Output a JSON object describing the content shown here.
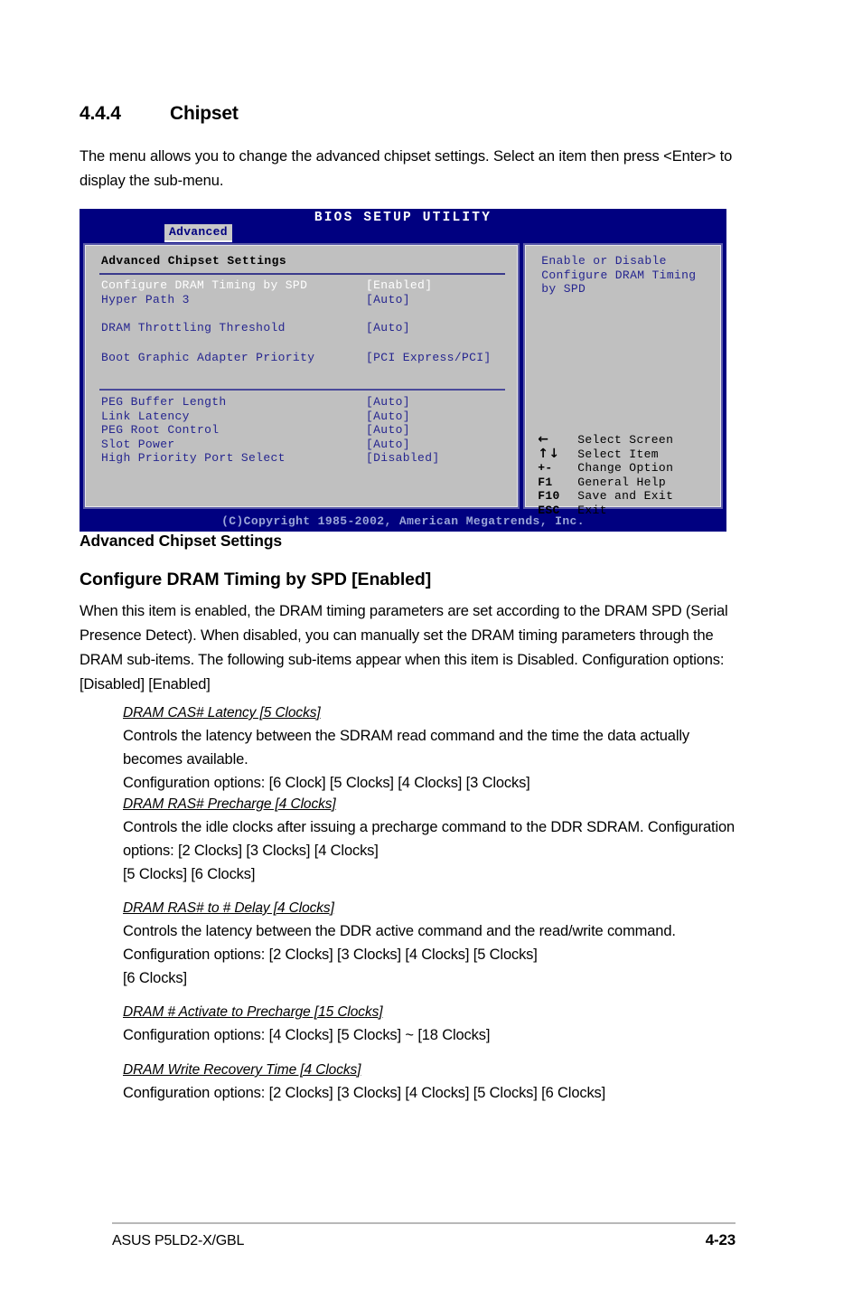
{
  "section": {
    "number": "4.4.4",
    "title": "Chipset",
    "intro": "The menu allows you to change the advanced chipset settings. Select an item then press <Enter> to display the sub-menu."
  },
  "bios": {
    "title": "BIOS SETUP UTILITY",
    "tab": "Advanced",
    "panel_heading": "Advanced Chipset Settings",
    "settings_group_1": [
      {
        "label": "Configure DRAM Timing by SPD",
        "value": "[Enabled]",
        "selected": true
      },
      {
        "label": "Hyper Path 3",
        "value": "[Auto]",
        "selected": false
      },
      {
        "label": "DRAM Throttling Threshold",
        "value": "[Auto]",
        "selected": false
      }
    ],
    "settings_group_2": [
      {
        "label": "Boot Graphic Adapter Priority",
        "value": "[PCI Express/PCI]",
        "selected": false
      }
    ],
    "settings_group_3": [
      {
        "label": "PEG Buffer Length",
        "value": "[Auto]",
        "selected": false
      },
      {
        "label": "Link Latency",
        "value": "[Auto]",
        "selected": false
      },
      {
        "label": "PEG Root Control",
        "value": "[Auto]",
        "selected": false
      },
      {
        "label": "Slot Power",
        "value": "[Auto]",
        "selected": false
      },
      {
        "label": "High Priority Port Select",
        "value": "[Disabled]",
        "selected": false
      }
    ],
    "help_text": "Enable or Disable\nConfigure DRAM Timing\nby SPD",
    "legend": [
      {
        "key": "←",
        "symbol": true,
        "text": "Select Screen"
      },
      {
        "key": "↑↓",
        "symbol": true,
        "text": "Select Item"
      },
      {
        "key": "+-",
        "symbol": false,
        "text": "Change Option"
      },
      {
        "key": "F1",
        "symbol": false,
        "text": "General Help"
      },
      {
        "key": "F10",
        "symbol": false,
        "text": "Save and Exit"
      },
      {
        "key": "ESC",
        "symbol": false,
        "text": "Exit"
      }
    ],
    "copyright": "(C)Copyright 1985-2002, American Megatrends, Inc.",
    "colors": {
      "titlebar": "#000080",
      "panel_bg": "#c0c0c0",
      "text": "#25258f",
      "selected_text": "#ffffff",
      "rule": "#3a3a8c"
    }
  },
  "content": {
    "heading_advanced": "Advanced Chipset Settings",
    "heading_configure": "Configure DRAM Timing by SPD [Enabled]",
    "paragraph_configure": "When this item is enabled, the DRAM timing parameters are set according to the DRAM SPD (Serial Presence Detect). When disabled, you can manually set the DRAM timing parameters through the DRAM sub-items. The following sub-items appear when this item is Disabled.      Configuration options: [Disabled] [Enabled]",
    "subitems": [
      {
        "title": "DRAM CAS# Latency [5 Clocks]",
        "body": "Controls the latency between the SDRAM read command and the time the data actually becomes available.\nConfiguration options: [6 Clock] [5 Clocks] [4 Clocks] [3 Clocks]"
      },
      {
        "title": "DRAM RAS# Precharge [4 Clocks]",
        "body": "Controls the idle clocks after issuing a precharge command to the DDR SDRAM. Configuration options: [2 Clocks] [3 Clocks] [4 Clocks]\n[5 Clocks] [6 Clocks]"
      },
      {
        "title": "DRAM RAS# to  # Delay [4 Clocks]",
        "body": "Controls the latency between the DDR   active command and the read/write command. Configuration options: [2 Clocks] [3 Clocks]  [4 Clocks] [5 Clocks]\n[6 Clocks]"
      },
      {
        "title": "DRAM  # Activate to Precharge [15 Clocks]",
        "body": "Configuration options: [4 Clocks] [5 Clocks] ~ [18 Clocks]"
      },
      {
        "title": "DRAM Write Recovery Time [4 Clocks]",
        "body": "Configuration options: [2 Clocks] [3 Clocks] [4 Clocks] [5 Clocks] [6 Clocks]"
      }
    ]
  },
  "footer": {
    "left": "ASUS P5LD2-X/GBL",
    "page": "4-23"
  }
}
